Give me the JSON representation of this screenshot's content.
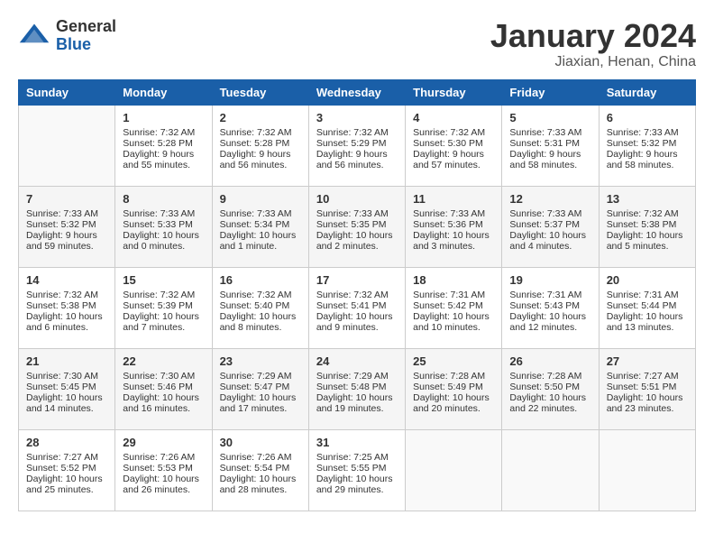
{
  "app": {
    "logo_general": "General",
    "logo_blue": "Blue"
  },
  "header": {
    "title": "January 2024",
    "location": "Jiaxian, Henan, China"
  },
  "days_of_week": [
    "Sunday",
    "Monday",
    "Tuesday",
    "Wednesday",
    "Thursday",
    "Friday",
    "Saturday"
  ],
  "weeks": [
    [
      {
        "day": "",
        "sunrise": "",
        "sunset": "",
        "daylight": ""
      },
      {
        "day": "1",
        "sunrise": "Sunrise: 7:32 AM",
        "sunset": "Sunset: 5:28 PM",
        "daylight": "Daylight: 9 hours and 55 minutes."
      },
      {
        "day": "2",
        "sunrise": "Sunrise: 7:32 AM",
        "sunset": "Sunset: 5:28 PM",
        "daylight": "Daylight: 9 hours and 56 minutes."
      },
      {
        "day": "3",
        "sunrise": "Sunrise: 7:32 AM",
        "sunset": "Sunset: 5:29 PM",
        "daylight": "Daylight: 9 hours and 56 minutes."
      },
      {
        "day": "4",
        "sunrise": "Sunrise: 7:32 AM",
        "sunset": "Sunset: 5:30 PM",
        "daylight": "Daylight: 9 hours and 57 minutes."
      },
      {
        "day": "5",
        "sunrise": "Sunrise: 7:33 AM",
        "sunset": "Sunset: 5:31 PM",
        "daylight": "Daylight: 9 hours and 58 minutes."
      },
      {
        "day": "6",
        "sunrise": "Sunrise: 7:33 AM",
        "sunset": "Sunset: 5:32 PM",
        "daylight": "Daylight: 9 hours and 58 minutes."
      }
    ],
    [
      {
        "day": "7",
        "sunrise": "Sunrise: 7:33 AM",
        "sunset": "Sunset: 5:32 PM",
        "daylight": "Daylight: 9 hours and 59 minutes."
      },
      {
        "day": "8",
        "sunrise": "Sunrise: 7:33 AM",
        "sunset": "Sunset: 5:33 PM",
        "daylight": "Daylight: 10 hours and 0 minutes."
      },
      {
        "day": "9",
        "sunrise": "Sunrise: 7:33 AM",
        "sunset": "Sunset: 5:34 PM",
        "daylight": "Daylight: 10 hours and 1 minute."
      },
      {
        "day": "10",
        "sunrise": "Sunrise: 7:33 AM",
        "sunset": "Sunset: 5:35 PM",
        "daylight": "Daylight: 10 hours and 2 minutes."
      },
      {
        "day": "11",
        "sunrise": "Sunrise: 7:33 AM",
        "sunset": "Sunset: 5:36 PM",
        "daylight": "Daylight: 10 hours and 3 minutes."
      },
      {
        "day": "12",
        "sunrise": "Sunrise: 7:33 AM",
        "sunset": "Sunset: 5:37 PM",
        "daylight": "Daylight: 10 hours and 4 minutes."
      },
      {
        "day": "13",
        "sunrise": "Sunrise: 7:32 AM",
        "sunset": "Sunset: 5:38 PM",
        "daylight": "Daylight: 10 hours and 5 minutes."
      }
    ],
    [
      {
        "day": "14",
        "sunrise": "Sunrise: 7:32 AM",
        "sunset": "Sunset: 5:38 PM",
        "daylight": "Daylight: 10 hours and 6 minutes."
      },
      {
        "day": "15",
        "sunrise": "Sunrise: 7:32 AM",
        "sunset": "Sunset: 5:39 PM",
        "daylight": "Daylight: 10 hours and 7 minutes."
      },
      {
        "day": "16",
        "sunrise": "Sunrise: 7:32 AM",
        "sunset": "Sunset: 5:40 PM",
        "daylight": "Daylight: 10 hours and 8 minutes."
      },
      {
        "day": "17",
        "sunrise": "Sunrise: 7:32 AM",
        "sunset": "Sunset: 5:41 PM",
        "daylight": "Daylight: 10 hours and 9 minutes."
      },
      {
        "day": "18",
        "sunrise": "Sunrise: 7:31 AM",
        "sunset": "Sunset: 5:42 PM",
        "daylight": "Daylight: 10 hours and 10 minutes."
      },
      {
        "day": "19",
        "sunrise": "Sunrise: 7:31 AM",
        "sunset": "Sunset: 5:43 PM",
        "daylight": "Daylight: 10 hours and 12 minutes."
      },
      {
        "day": "20",
        "sunrise": "Sunrise: 7:31 AM",
        "sunset": "Sunset: 5:44 PM",
        "daylight": "Daylight: 10 hours and 13 minutes."
      }
    ],
    [
      {
        "day": "21",
        "sunrise": "Sunrise: 7:30 AM",
        "sunset": "Sunset: 5:45 PM",
        "daylight": "Daylight: 10 hours and 14 minutes."
      },
      {
        "day": "22",
        "sunrise": "Sunrise: 7:30 AM",
        "sunset": "Sunset: 5:46 PM",
        "daylight": "Daylight: 10 hours and 16 minutes."
      },
      {
        "day": "23",
        "sunrise": "Sunrise: 7:29 AM",
        "sunset": "Sunset: 5:47 PM",
        "daylight": "Daylight: 10 hours and 17 minutes."
      },
      {
        "day": "24",
        "sunrise": "Sunrise: 7:29 AM",
        "sunset": "Sunset: 5:48 PM",
        "daylight": "Daylight: 10 hours and 19 minutes."
      },
      {
        "day": "25",
        "sunrise": "Sunrise: 7:28 AM",
        "sunset": "Sunset: 5:49 PM",
        "daylight": "Daylight: 10 hours and 20 minutes."
      },
      {
        "day": "26",
        "sunrise": "Sunrise: 7:28 AM",
        "sunset": "Sunset: 5:50 PM",
        "daylight": "Daylight: 10 hours and 22 minutes."
      },
      {
        "day": "27",
        "sunrise": "Sunrise: 7:27 AM",
        "sunset": "Sunset: 5:51 PM",
        "daylight": "Daylight: 10 hours and 23 minutes."
      }
    ],
    [
      {
        "day": "28",
        "sunrise": "Sunrise: 7:27 AM",
        "sunset": "Sunset: 5:52 PM",
        "daylight": "Daylight: 10 hours and 25 minutes."
      },
      {
        "day": "29",
        "sunrise": "Sunrise: 7:26 AM",
        "sunset": "Sunset: 5:53 PM",
        "daylight": "Daylight: 10 hours and 26 minutes."
      },
      {
        "day": "30",
        "sunrise": "Sunrise: 7:26 AM",
        "sunset": "Sunset: 5:54 PM",
        "daylight": "Daylight: 10 hours and 28 minutes."
      },
      {
        "day": "31",
        "sunrise": "Sunrise: 7:25 AM",
        "sunset": "Sunset: 5:55 PM",
        "daylight": "Daylight: 10 hours and 29 minutes."
      },
      {
        "day": "",
        "sunrise": "",
        "sunset": "",
        "daylight": ""
      },
      {
        "day": "",
        "sunrise": "",
        "sunset": "",
        "daylight": ""
      },
      {
        "day": "",
        "sunrise": "",
        "sunset": "",
        "daylight": ""
      }
    ]
  ]
}
